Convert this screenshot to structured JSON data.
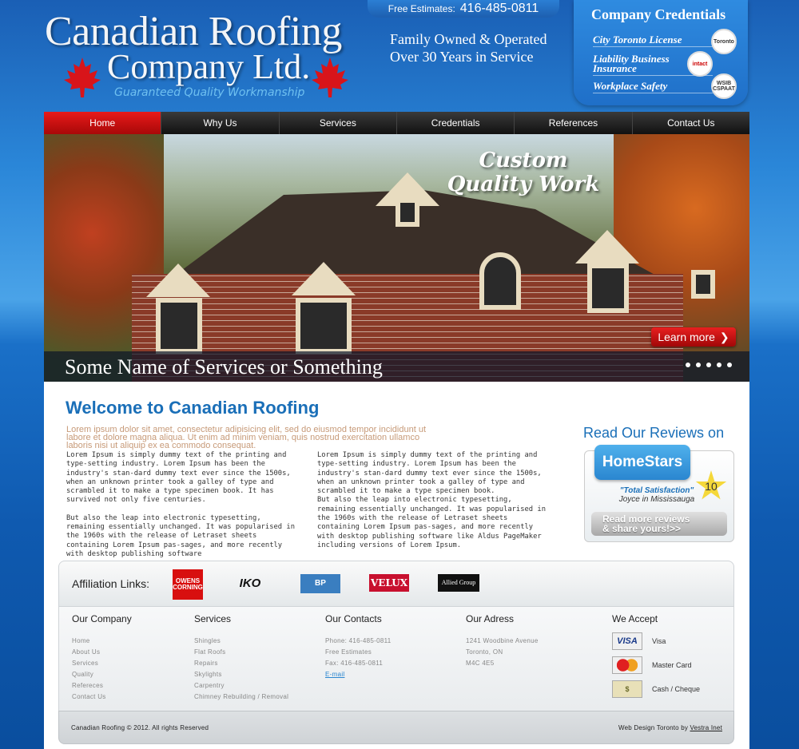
{
  "header": {
    "logo_line1": "Canadian Roofing",
    "logo_line2": "Company Ltd.",
    "logo_tagline": "Guaranteed Quality Workmanship",
    "family_line1": "Family Owned & Operated",
    "family_line2": "Over 30 Years in Service",
    "estimates_label": "Free Estimates:",
    "estimates_phone": "416-485-0811",
    "credentials_title": "Company Credentials",
    "credentials": [
      {
        "label": "City Toronto License",
        "badge": "Toronto"
      },
      {
        "label": "Liability Business Insurance",
        "badge": "intact"
      },
      {
        "label": "Workplace Safety",
        "badge": "WSIB CSPAAT"
      }
    ]
  },
  "nav": {
    "items": [
      "Home",
      "Why Us",
      "Services",
      "Credentials",
      "References",
      "Contact Us"
    ],
    "active": "Home"
  },
  "banner": {
    "script_line1": "Custom",
    "script_line2": "Quality Work",
    "caption": "Some Name of Services or Something",
    "learn_more": "Learn more",
    "slide_count": 5
  },
  "main": {
    "welcome_title": "Welcome to Canadian Roofing",
    "lead": "Lorem ipsum dolor sit amet, consectetur adipisicing elit, sed do eiusmod tempor incididunt ut labore et dolore magna aliqua. Ut enim ad minim veniam, quis nostrud exercitation ullamco laboris nisi ut aliquip ex ea commodo consequat.",
    "col1_p1": "Lorem Ipsum is simply dummy text of the printing and type-setting industry. Lorem Ipsum has been the industry's stan-dard dummy text ever since the 1500s, when an unknown printer took a galley of type and scrambled it to make a type specimen book. It has survived not only five centuries.",
    "col1_p2": "But also the leap into electronic typesetting, remaining essentially unchanged. It was popularised in the 1960s with the release of Letraset sheets containing Lorem Ipsum pas-sages, and more recently with desktop publishing software",
    "col2_p1": "Lorem Ipsum is simply dummy text of the printing and type-setting industry. Lorem Ipsum has been the industry's stan-dard dummy text ever since the 1500s, when an unknown printer took a galley of type and scrambled it to make a type specimen book.",
    "col2_p2": "But also the leap into electronic typesetting, remaining essentially unchanged. It was popularised in the 1960s with the release of Letraset sheets containing Lorem Ipsum pas-sages, and more recently with desktop publishing software like Aldus PageMaker including versions of Lorem Ipsum."
  },
  "reviews": {
    "title": "Read Our Reviews on",
    "brand": "HomeStars",
    "quote": "\"Total Satisfaction\"",
    "author": "Joyce in Mississauga",
    "score": "10",
    "button_line1": "Read more reviews",
    "button_line2": "& share yours!>>"
  },
  "affiliation": {
    "label": "Affiliation Links:",
    "logos": [
      "OWENS CORNING",
      "IKO",
      "BP",
      "VELUX",
      "Allied Group"
    ]
  },
  "footer": {
    "company": {
      "title": "Our Company",
      "items": [
        "Home",
        "About Us",
        "Services",
        "Quality",
        "Refereces",
        "Contact Us"
      ]
    },
    "services": {
      "title": "Services",
      "items": [
        "Shingles",
        "Flat Roofs",
        "Repairs",
        "Skylights",
        "Carpentry",
        "Chimney Rebuilding / Removal"
      ]
    },
    "contacts": {
      "title": "Our Contacts",
      "items": [
        "Phone: 416-485-0811",
        "Free Estimates",
        "Fax: 416-485-0811"
      ],
      "email": "E-mail"
    },
    "address": {
      "title": "Our Adress",
      "items": [
        "1241 Woodbine Avenue",
        "Toronto, ON",
        "M4C 4E5"
      ]
    },
    "accept": {
      "title": "We Accept",
      "items": [
        {
          "card": "VISA",
          "label": "Visa"
        },
        {
          "card": "MasterCard",
          "label": "Master Card"
        },
        {
          "card": "cash",
          "label": "Cash / Cheque"
        }
      ]
    },
    "copyright": "Canadian Roofing © 2012. All rights Reserved",
    "credit_prefix": "Web Design Toronto by",
    "credit_link": "Vestra Inet"
  },
  "colors": {
    "accent": "#1a6fb8",
    "nav_active": "#d81010",
    "brand_red": "#d80f0f"
  }
}
